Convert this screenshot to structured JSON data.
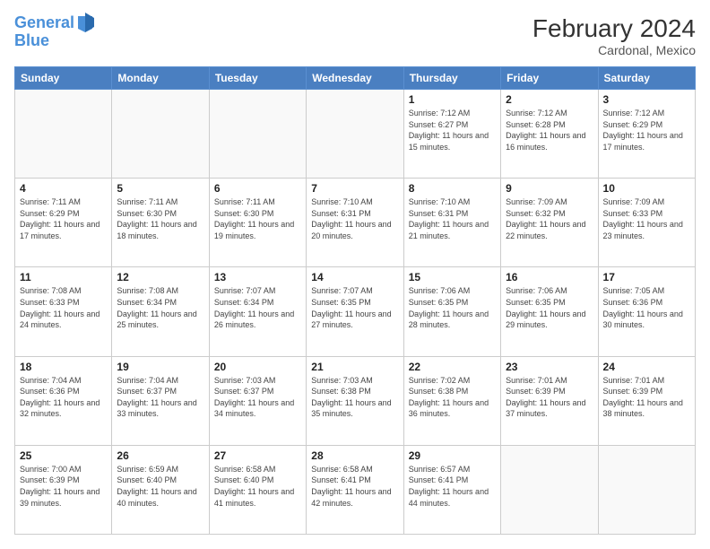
{
  "header": {
    "logo_line1": "General",
    "logo_line2": "Blue",
    "month_year": "February 2024",
    "location": "Cardonal, Mexico"
  },
  "weekdays": [
    "Sunday",
    "Monday",
    "Tuesday",
    "Wednesday",
    "Thursday",
    "Friday",
    "Saturday"
  ],
  "weeks": [
    [
      {
        "day": "",
        "info": ""
      },
      {
        "day": "",
        "info": ""
      },
      {
        "day": "",
        "info": ""
      },
      {
        "day": "",
        "info": ""
      },
      {
        "day": "1",
        "info": "Sunrise: 7:12 AM\nSunset: 6:27 PM\nDaylight: 11 hours and 15 minutes."
      },
      {
        "day": "2",
        "info": "Sunrise: 7:12 AM\nSunset: 6:28 PM\nDaylight: 11 hours and 16 minutes."
      },
      {
        "day": "3",
        "info": "Sunrise: 7:12 AM\nSunset: 6:29 PM\nDaylight: 11 hours and 17 minutes."
      }
    ],
    [
      {
        "day": "4",
        "info": "Sunrise: 7:11 AM\nSunset: 6:29 PM\nDaylight: 11 hours and 17 minutes."
      },
      {
        "day": "5",
        "info": "Sunrise: 7:11 AM\nSunset: 6:30 PM\nDaylight: 11 hours and 18 minutes."
      },
      {
        "day": "6",
        "info": "Sunrise: 7:11 AM\nSunset: 6:30 PM\nDaylight: 11 hours and 19 minutes."
      },
      {
        "day": "7",
        "info": "Sunrise: 7:10 AM\nSunset: 6:31 PM\nDaylight: 11 hours and 20 minutes."
      },
      {
        "day": "8",
        "info": "Sunrise: 7:10 AM\nSunset: 6:31 PM\nDaylight: 11 hours and 21 minutes."
      },
      {
        "day": "9",
        "info": "Sunrise: 7:09 AM\nSunset: 6:32 PM\nDaylight: 11 hours and 22 minutes."
      },
      {
        "day": "10",
        "info": "Sunrise: 7:09 AM\nSunset: 6:33 PM\nDaylight: 11 hours and 23 minutes."
      }
    ],
    [
      {
        "day": "11",
        "info": "Sunrise: 7:08 AM\nSunset: 6:33 PM\nDaylight: 11 hours and 24 minutes."
      },
      {
        "day": "12",
        "info": "Sunrise: 7:08 AM\nSunset: 6:34 PM\nDaylight: 11 hours and 25 minutes."
      },
      {
        "day": "13",
        "info": "Sunrise: 7:07 AM\nSunset: 6:34 PM\nDaylight: 11 hours and 26 minutes."
      },
      {
        "day": "14",
        "info": "Sunrise: 7:07 AM\nSunset: 6:35 PM\nDaylight: 11 hours and 27 minutes."
      },
      {
        "day": "15",
        "info": "Sunrise: 7:06 AM\nSunset: 6:35 PM\nDaylight: 11 hours and 28 minutes."
      },
      {
        "day": "16",
        "info": "Sunrise: 7:06 AM\nSunset: 6:35 PM\nDaylight: 11 hours and 29 minutes."
      },
      {
        "day": "17",
        "info": "Sunrise: 7:05 AM\nSunset: 6:36 PM\nDaylight: 11 hours and 30 minutes."
      }
    ],
    [
      {
        "day": "18",
        "info": "Sunrise: 7:04 AM\nSunset: 6:36 PM\nDaylight: 11 hours and 32 minutes."
      },
      {
        "day": "19",
        "info": "Sunrise: 7:04 AM\nSunset: 6:37 PM\nDaylight: 11 hours and 33 minutes."
      },
      {
        "day": "20",
        "info": "Sunrise: 7:03 AM\nSunset: 6:37 PM\nDaylight: 11 hours and 34 minutes."
      },
      {
        "day": "21",
        "info": "Sunrise: 7:03 AM\nSunset: 6:38 PM\nDaylight: 11 hours and 35 minutes."
      },
      {
        "day": "22",
        "info": "Sunrise: 7:02 AM\nSunset: 6:38 PM\nDaylight: 11 hours and 36 minutes."
      },
      {
        "day": "23",
        "info": "Sunrise: 7:01 AM\nSunset: 6:39 PM\nDaylight: 11 hours and 37 minutes."
      },
      {
        "day": "24",
        "info": "Sunrise: 7:01 AM\nSunset: 6:39 PM\nDaylight: 11 hours and 38 minutes."
      }
    ],
    [
      {
        "day": "25",
        "info": "Sunrise: 7:00 AM\nSunset: 6:39 PM\nDaylight: 11 hours and 39 minutes."
      },
      {
        "day": "26",
        "info": "Sunrise: 6:59 AM\nSunset: 6:40 PM\nDaylight: 11 hours and 40 minutes."
      },
      {
        "day": "27",
        "info": "Sunrise: 6:58 AM\nSunset: 6:40 PM\nDaylight: 11 hours and 41 minutes."
      },
      {
        "day": "28",
        "info": "Sunrise: 6:58 AM\nSunset: 6:41 PM\nDaylight: 11 hours and 42 minutes."
      },
      {
        "day": "29",
        "info": "Sunrise: 6:57 AM\nSunset: 6:41 PM\nDaylight: 11 hours and 44 minutes."
      },
      {
        "day": "",
        "info": ""
      },
      {
        "day": "",
        "info": ""
      }
    ]
  ]
}
